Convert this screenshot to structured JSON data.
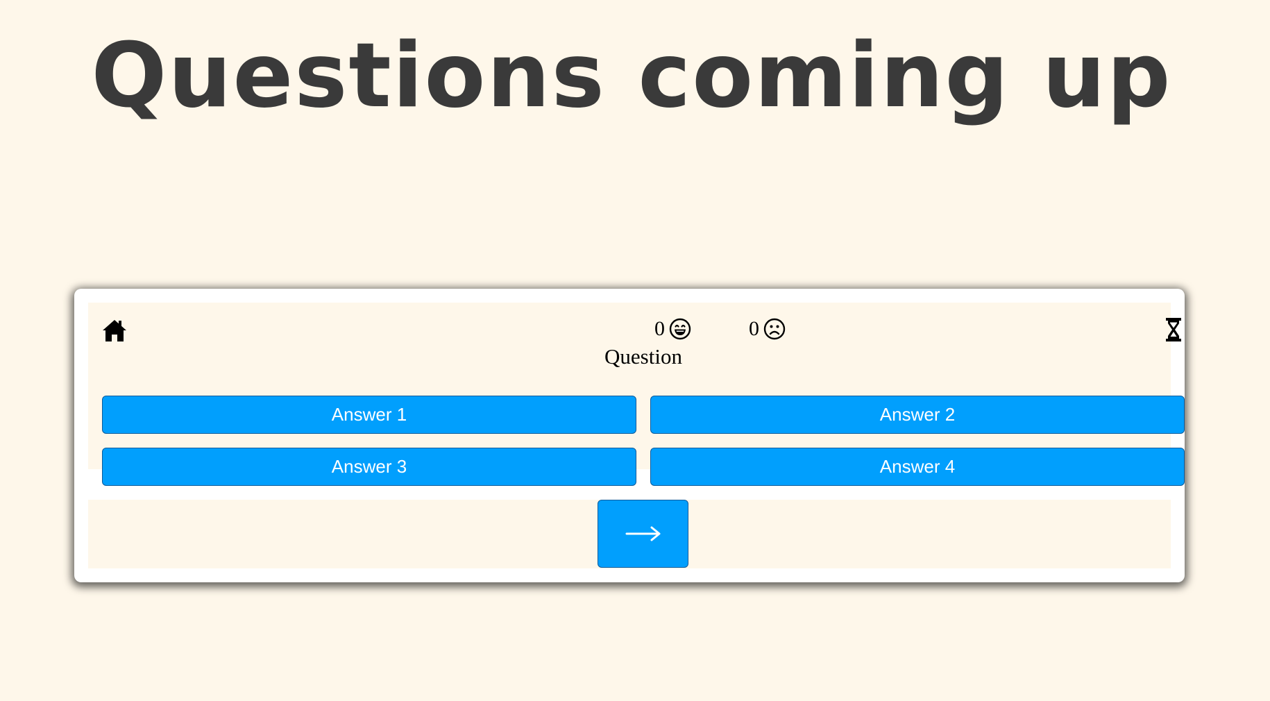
{
  "page": {
    "title": "Questions coming up"
  },
  "quiz": {
    "score": {
      "correct": "0",
      "wrong": "0"
    },
    "question": "Question",
    "answers": [
      "Answer 1",
      "Answer 2",
      "Answer 3",
      "Answer 4"
    ],
    "icons": {
      "home": "home-icon",
      "timer": "hourglass-icon",
      "correct": "grinning-face-icon",
      "wrong": "frowning-face-icon",
      "next": "right-arrow-icon"
    }
  },
  "colors": {
    "background": "#fef7ea",
    "button": "#019ffd",
    "title": "#3a3a3a"
  }
}
